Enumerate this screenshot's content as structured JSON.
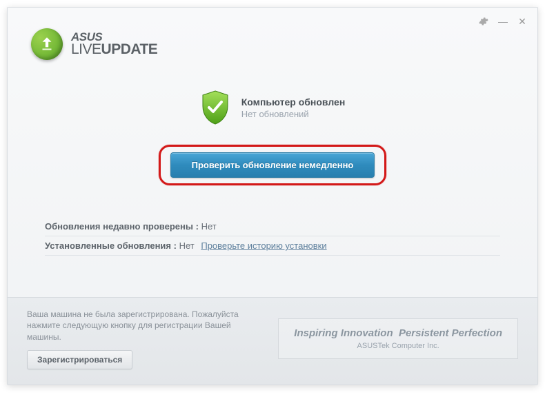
{
  "brand": {
    "top": "ASUS",
    "live": "LIVE",
    "update": "UPDATE"
  },
  "status": {
    "title": "Компьютер обновлен",
    "subtitle": "Нет обновлений"
  },
  "check_button": "Проверить обновление немедленно",
  "info": {
    "recent_label": "Обновления недавно проверены :",
    "recent_value": "Нет",
    "installed_label": "Установленные обновления :",
    "installed_value": "Нет",
    "history_link": "Проверьте историю установки"
  },
  "registration": {
    "text": "Ваша машина не была зарегистрирована. Пожалуйста нажмите следующую кнопку для регистрации Вашей машины.",
    "button": "Зарегистрироваться"
  },
  "slogan": {
    "main": "Inspiring Innovation  Persistent Perfection",
    "sub": "ASUSTek Computer Inc."
  }
}
